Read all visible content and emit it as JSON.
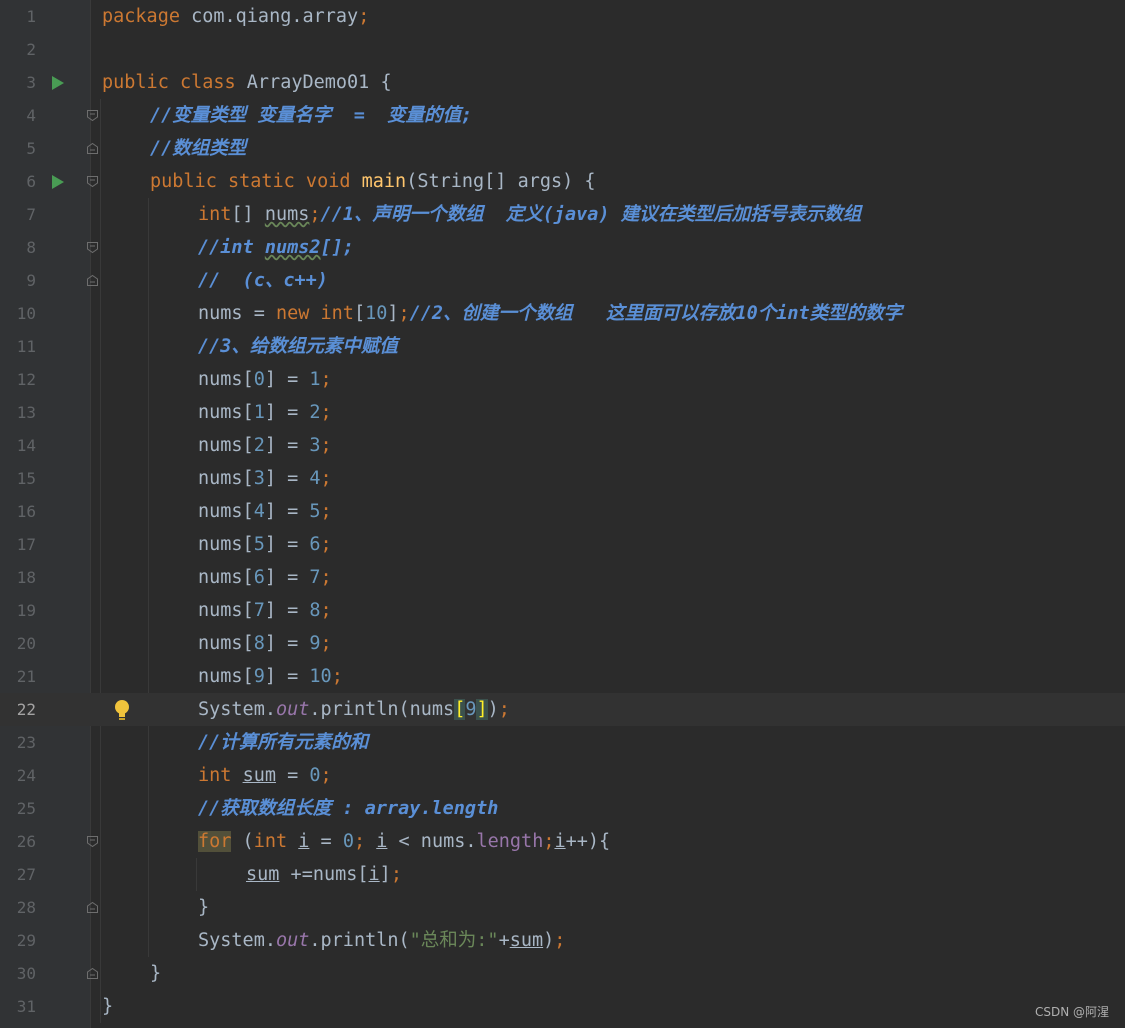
{
  "editor": {
    "language": "java",
    "active_line": 22,
    "lines": [
      {
        "n": "1",
        "tokens": [
          {
            "t": "package",
            "c": "kw"
          },
          {
            "t": " com.qiang.array",
            "c": ""
          },
          {
            "t": ";",
            "c": "kw"
          }
        ]
      },
      {
        "n": "2",
        "tokens": []
      },
      {
        "n": "3",
        "run": true,
        "tokens": [
          {
            "t": "public class ",
            "c": "kw"
          },
          {
            "t": "ArrayDemo01 {",
            "c": ""
          }
        ]
      },
      {
        "n": "4",
        "fold": "open",
        "indent": 1,
        "tokens": [
          {
            "t": "//变量类型 变量名字  =  变量的值;",
            "c": "cmb"
          }
        ]
      },
      {
        "n": "5",
        "fold": "close",
        "indent": 1,
        "tokens": [
          {
            "t": "//数组类型",
            "c": "cmb"
          }
        ]
      },
      {
        "n": "6",
        "run": true,
        "fold": "open",
        "indent": 1,
        "tokens": [
          {
            "t": "public static void ",
            "c": "kw"
          },
          {
            "t": "main",
            "c": "fn"
          },
          {
            "t": "(String[] args) {",
            "c": ""
          }
        ]
      },
      {
        "n": "7",
        "indent": 2,
        "tokens": [
          {
            "t": "int",
            "c": "kw"
          },
          {
            "t": "[] ",
            "c": ""
          },
          {
            "t": "nums",
            "c": "wavy"
          },
          {
            "t": ";",
            "c": "kw"
          },
          {
            "t": "//1、声明一个数组  定义(java) 建议在类型后加括号表示数组",
            "c": "cmb"
          }
        ]
      },
      {
        "n": "8",
        "fold": "open",
        "indent": 2,
        "tokens": [
          {
            "t": "//int ",
            "c": "cmb"
          },
          {
            "t": "nums2",
            "c": "cmb wavy"
          },
          {
            "t": "[];",
            "c": "cmb"
          }
        ]
      },
      {
        "n": "9",
        "fold": "close",
        "indent": 2,
        "tokens": [
          {
            "t": "//  (c、c++)",
            "c": "cmb"
          }
        ]
      },
      {
        "n": "10",
        "indent": 2,
        "tokens": [
          {
            "t": "nums = ",
            "c": ""
          },
          {
            "t": "new int",
            "c": "kw"
          },
          {
            "t": "[",
            "c": ""
          },
          {
            "t": "10",
            "c": "num"
          },
          {
            "t": "]",
            "c": ""
          },
          {
            "t": ";",
            "c": "kw"
          },
          {
            "t": "//2、创建一个数组   这里面可以存放10个int类型的数字",
            "c": "cmb"
          }
        ]
      },
      {
        "n": "11",
        "indent": 2,
        "tokens": [
          {
            "t": "//3、给数组元素中赋值",
            "c": "cmb"
          }
        ]
      },
      {
        "n": "12",
        "indent": 2,
        "tokens": [
          {
            "t": "nums[",
            "c": ""
          },
          {
            "t": "0",
            "c": "num"
          },
          {
            "t": "] = ",
            "c": ""
          },
          {
            "t": "1",
            "c": "num"
          },
          {
            "t": ";",
            "c": "kw"
          }
        ]
      },
      {
        "n": "13",
        "indent": 2,
        "tokens": [
          {
            "t": "nums[",
            "c": ""
          },
          {
            "t": "1",
            "c": "num"
          },
          {
            "t": "] = ",
            "c": ""
          },
          {
            "t": "2",
            "c": "num"
          },
          {
            "t": ";",
            "c": "kw"
          }
        ]
      },
      {
        "n": "14",
        "indent": 2,
        "tokens": [
          {
            "t": "nums[",
            "c": ""
          },
          {
            "t": "2",
            "c": "num"
          },
          {
            "t": "] = ",
            "c": ""
          },
          {
            "t": "3",
            "c": "num"
          },
          {
            "t": ";",
            "c": "kw"
          }
        ]
      },
      {
        "n": "15",
        "indent": 2,
        "tokens": [
          {
            "t": "nums[",
            "c": ""
          },
          {
            "t": "3",
            "c": "num"
          },
          {
            "t": "] = ",
            "c": ""
          },
          {
            "t": "4",
            "c": "num"
          },
          {
            "t": ";",
            "c": "kw"
          }
        ]
      },
      {
        "n": "16",
        "indent": 2,
        "tokens": [
          {
            "t": "nums[",
            "c": ""
          },
          {
            "t": "4",
            "c": "num"
          },
          {
            "t": "] = ",
            "c": ""
          },
          {
            "t": "5",
            "c": "num"
          },
          {
            "t": ";",
            "c": "kw"
          }
        ]
      },
      {
        "n": "17",
        "indent": 2,
        "tokens": [
          {
            "t": "nums[",
            "c": ""
          },
          {
            "t": "5",
            "c": "num"
          },
          {
            "t": "] = ",
            "c": ""
          },
          {
            "t": "6",
            "c": "num"
          },
          {
            "t": ";",
            "c": "kw"
          }
        ]
      },
      {
        "n": "18",
        "indent": 2,
        "tokens": [
          {
            "t": "nums[",
            "c": ""
          },
          {
            "t": "6",
            "c": "num"
          },
          {
            "t": "] = ",
            "c": ""
          },
          {
            "t": "7",
            "c": "num"
          },
          {
            "t": ";",
            "c": "kw"
          }
        ]
      },
      {
        "n": "19",
        "indent": 2,
        "tokens": [
          {
            "t": "nums[",
            "c": ""
          },
          {
            "t": "7",
            "c": "num"
          },
          {
            "t": "] = ",
            "c": ""
          },
          {
            "t": "8",
            "c": "num"
          },
          {
            "t": ";",
            "c": "kw"
          }
        ]
      },
      {
        "n": "20",
        "indent": 2,
        "tokens": [
          {
            "t": "nums[",
            "c": ""
          },
          {
            "t": "8",
            "c": "num"
          },
          {
            "t": "] = ",
            "c": ""
          },
          {
            "t": "9",
            "c": "num"
          },
          {
            "t": ";",
            "c": "kw"
          }
        ]
      },
      {
        "n": "21",
        "indent": 2,
        "tokens": [
          {
            "t": "nums[",
            "c": ""
          },
          {
            "t": "9",
            "c": "num"
          },
          {
            "t": "] = ",
            "c": ""
          },
          {
            "t": "10",
            "c": "num"
          },
          {
            "t": ";",
            "c": "kw"
          }
        ]
      },
      {
        "n": "22",
        "bulb": true,
        "indent": 2,
        "tokens": [
          {
            "t": "System.",
            "c": ""
          },
          {
            "t": "out",
            "c": "fld"
          },
          {
            "t": ".println(nums",
            "c": ""
          },
          {
            "t": "[",
            "c": "br-hl"
          },
          {
            "t": "9",
            "c": "num"
          },
          {
            "t": "]",
            "c": "br-hl"
          },
          {
            "t": ")",
            "c": ""
          },
          {
            "t": ";",
            "c": "kw"
          }
        ]
      },
      {
        "n": "23",
        "indent": 2,
        "tokens": [
          {
            "t": "//计算所有元素的和",
            "c": "cmb"
          }
        ]
      },
      {
        "n": "24",
        "indent": 2,
        "tokens": [
          {
            "t": "int ",
            "c": "kw"
          },
          {
            "t": "sum",
            "c": "ul"
          },
          {
            "t": " = ",
            "c": ""
          },
          {
            "t": "0",
            "c": "num"
          },
          {
            "t": ";",
            "c": "kw"
          }
        ]
      },
      {
        "n": "25",
        "indent": 2,
        "tokens": [
          {
            "t": "//获取数组长度 : array.length",
            "c": "cmb"
          }
        ]
      },
      {
        "n": "26",
        "fold": "open",
        "indent": 2,
        "tokens": [
          {
            "t": "for",
            "c": "kw for-hl"
          },
          {
            "t": " (",
            "c": ""
          },
          {
            "t": "int ",
            "c": "kw"
          },
          {
            "t": "i",
            "c": "ul"
          },
          {
            "t": " = ",
            "c": ""
          },
          {
            "t": "0",
            "c": "num"
          },
          {
            "t": "; ",
            "c": "kw"
          },
          {
            "t": "i",
            "c": "ul"
          },
          {
            "t": " < nums.",
            "c": ""
          },
          {
            "t": "length",
            "c": "prop"
          },
          {
            "t": ";",
            "c": "kw"
          },
          {
            "t": "i",
            "c": "ul"
          },
          {
            "t": "++){",
            "c": ""
          }
        ]
      },
      {
        "n": "27",
        "indent": 3,
        "tokens": [
          {
            "t": "sum",
            "c": "ul"
          },
          {
            "t": " +=nums[",
            "c": ""
          },
          {
            "t": "i",
            "c": "ul"
          },
          {
            "t": "]",
            "c": ""
          },
          {
            "t": ";",
            "c": "kw"
          }
        ]
      },
      {
        "n": "28",
        "fold": "close",
        "indent": 2,
        "tokens": [
          {
            "t": "}",
            "c": ""
          }
        ]
      },
      {
        "n": "29",
        "indent": 2,
        "tokens": [
          {
            "t": "System.",
            "c": ""
          },
          {
            "t": "out",
            "c": "fld"
          },
          {
            "t": ".println(",
            "c": ""
          },
          {
            "t": "\"总和为:\"",
            "c": "str"
          },
          {
            "t": "+",
            "c": ""
          },
          {
            "t": "sum",
            "c": "ul"
          },
          {
            "t": ")",
            "c": ""
          },
          {
            "t": ";",
            "c": "kw"
          }
        ]
      },
      {
        "n": "30",
        "fold": "close",
        "indent": 1,
        "tokens": [
          {
            "t": "}",
            "c": ""
          }
        ]
      },
      {
        "n": "31",
        "indent": 0,
        "tokens": [
          {
            "t": "}",
            "c": ""
          }
        ]
      }
    ]
  },
  "watermark": "CSDN @阿湦",
  "colors": {
    "background": "#2b2b2b",
    "gutter": "#313335",
    "keyword": "#cc7832",
    "comment": "#5a8fd6",
    "number": "#6897bb",
    "string": "#6a8759",
    "method": "#ffc66d",
    "field": "#9876aa"
  }
}
